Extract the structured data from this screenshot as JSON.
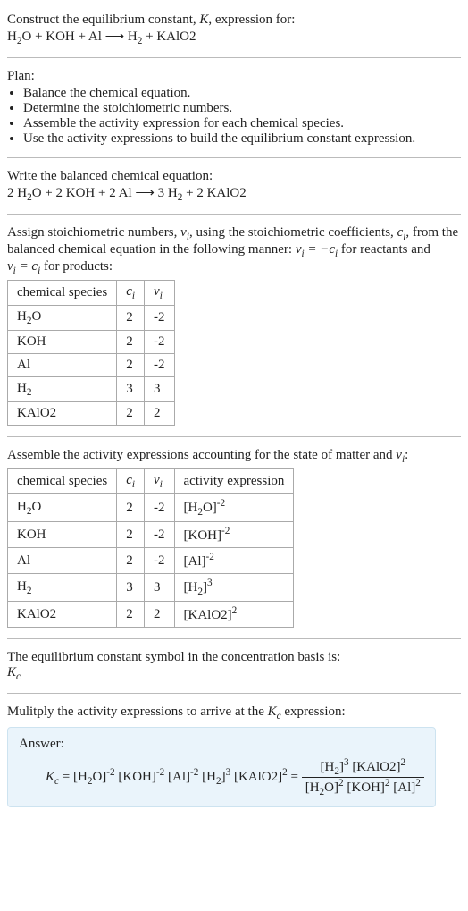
{
  "prompt": {
    "line1_a": "Construct the equilibrium constant, ",
    "line1_b": ", expression for:",
    "line2_h2o": "H",
    "line2_koh": " + KOH + Al  ⟶  H",
    "line2_end": " + KAlO2"
  },
  "plan": {
    "heading": "Plan:",
    "items": [
      "Balance the chemical equation.",
      "Determine the stoichiometric numbers.",
      "Assemble the activity expression for each chemical species.",
      "Use the activity expressions to build the equilibrium constant expression."
    ]
  },
  "balanced": {
    "heading": "Write the balanced chemical equation:",
    "c1": "2 H",
    "c2": "O + 2 KOH + 2 Al  ⟶  3 H",
    "c3": " + 2 KAlO2"
  },
  "assign": {
    "text_a": "Assign stoichiometric numbers, ",
    "text_b": ", using the stoichiometric coefficients, ",
    "text_c": ", from the balanced chemical equation in the following manner: ",
    "text_d": " for reactants and ",
    "text_e": " for products:",
    "nu_i": "ν",
    "c_i": "c",
    "eq_r1": "ν",
    "eq_r2": " = −c",
    "eq_p1": "ν",
    "eq_p2": " = c",
    "headers": [
      "chemical species",
      "c",
      "ν"
    ],
    "rows": [
      {
        "sp_a": "H",
        "sp_sub": "2",
        "sp_b": "O",
        "c": "2",
        "nu": "-2"
      },
      {
        "sp_a": "KOH",
        "sp_sub": "",
        "sp_b": "",
        "c": "2",
        "nu": "-2"
      },
      {
        "sp_a": "Al",
        "sp_sub": "",
        "sp_b": "",
        "c": "2",
        "nu": "-2"
      },
      {
        "sp_a": "H",
        "sp_sub": "2",
        "sp_b": "",
        "c": "3",
        "nu": "3"
      },
      {
        "sp_a": "KAlO2",
        "sp_sub": "",
        "sp_b": "",
        "c": "2",
        "nu": "2"
      }
    ]
  },
  "activity": {
    "heading_a": "Assemble the activity expressions accounting for the state of matter and ",
    "heading_b": ":",
    "headers": [
      "chemical species",
      "c",
      "ν",
      "activity expression"
    ],
    "rows": [
      {
        "sp_a": "H",
        "sp_sub": "2",
        "sp_b": "O",
        "c": "2",
        "nu": "-2",
        "act_base": "[H",
        "act_sub": "2",
        "act_mid": "O]",
        "act_exp": "-2"
      },
      {
        "sp_a": "KOH",
        "sp_sub": "",
        "sp_b": "",
        "c": "2",
        "nu": "-2",
        "act_base": "[KOH]",
        "act_sub": "",
        "act_mid": "",
        "act_exp": "-2"
      },
      {
        "sp_a": "Al",
        "sp_sub": "",
        "sp_b": "",
        "c": "2",
        "nu": "-2",
        "act_base": "[Al]",
        "act_sub": "",
        "act_mid": "",
        "act_exp": "-2"
      },
      {
        "sp_a": "H",
        "sp_sub": "2",
        "sp_b": "",
        "c": "3",
        "nu": "3",
        "act_base": "[H",
        "act_sub": "2",
        "act_mid": "]",
        "act_exp": "3"
      },
      {
        "sp_a": "KAlO2",
        "sp_sub": "",
        "sp_b": "",
        "c": "2",
        "nu": "2",
        "act_base": "[KAlO2]",
        "act_sub": "",
        "act_mid": "",
        "act_exp": "2"
      }
    ]
  },
  "symbol": {
    "line1": "The equilibrium constant symbol in the concentration basis is:",
    "kc": "K"
  },
  "multiply": {
    "heading_a": "Mulitply the activity expressions to arrive at the ",
    "heading_b": " expression:"
  },
  "answer": {
    "label": "Answer:",
    "kc": "K",
    "eq": " = [H",
    "t1": "O]",
    "t2": " [KOH]",
    "t3": " [Al]",
    "t4": " [H",
    "t5": "]",
    "t6": " [KAlO2]",
    "eq2": " = ",
    "num1": "[H",
    "num2": "]",
    "num3": " [KAlO2]",
    "den1": "[H",
    "den2": "O]",
    "den3": " [KOH]",
    "den4": " [Al]",
    "e_m2": "-2",
    "e_2": "2",
    "e_3": "3"
  }
}
